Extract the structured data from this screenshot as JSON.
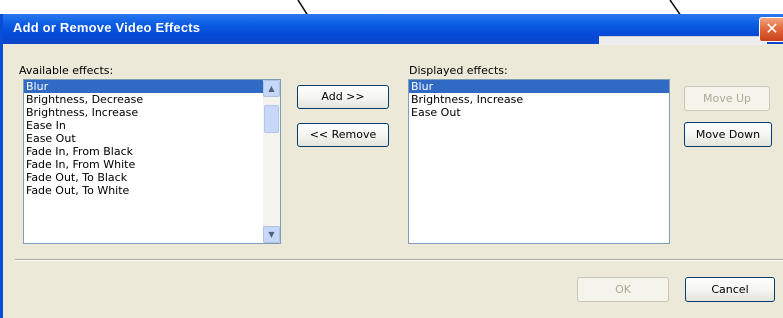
{
  "dialog": {
    "title": "Add or Remove Video Effects",
    "close_glyph": "✕"
  },
  "available": {
    "label": "Available effects:",
    "items": [
      "Blur",
      "Brightness, Decrease",
      "Brightness, Increase",
      "Ease In",
      "Ease Out",
      "Fade In, From Black",
      "Fade In, From White",
      "Fade Out, To Black",
      "Fade Out, To White"
    ],
    "selected": "Blur",
    "scroll_up_glyph": "▲",
    "scroll_down_glyph": "▼"
  },
  "displayed": {
    "label": "Displayed effects:",
    "items": [
      "Blur",
      "Brightness, Increase",
      "Ease Out"
    ],
    "selected": "Blur"
  },
  "buttons": {
    "add": "Add >>",
    "remove": "<< Remove",
    "move_up": "Move Up",
    "move_down": "Move Down",
    "ok": "OK",
    "cancel": "Cancel"
  },
  "colors": {
    "title_bar": "#0A5CE3",
    "selection": "#316AC5",
    "dialog_bg": "#ECE9D8",
    "close_button": "#E16A3F"
  }
}
